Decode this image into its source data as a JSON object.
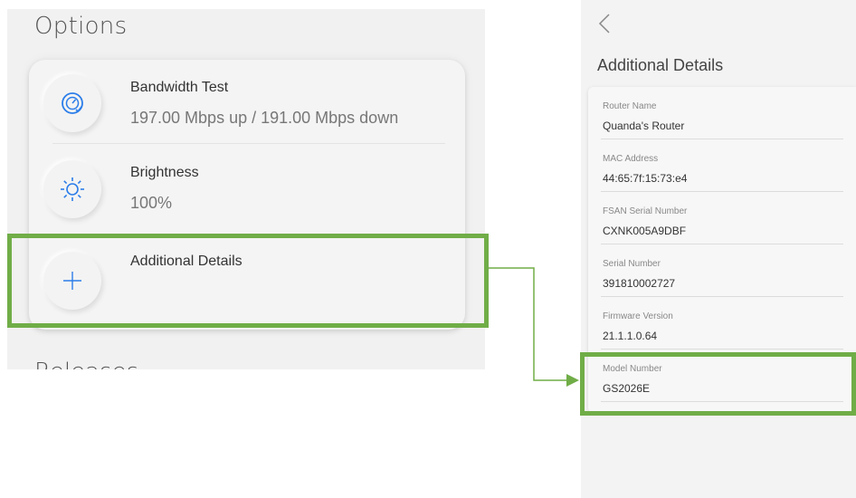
{
  "options_panel": {
    "title": "Options",
    "items": [
      {
        "icon": "speedometer-icon",
        "title": "Bandwidth Test",
        "subtitle": "197.00 Mbps up / 191.00 Mbps down"
      },
      {
        "icon": "brightness-icon",
        "title": "Brightness",
        "subtitle": "100%"
      },
      {
        "icon": "plus-icon",
        "title": "Additional Details",
        "subtitle": ""
      }
    ],
    "next_heading_partial": "Releases"
  },
  "details_panel": {
    "title": "Additional Details",
    "rows": [
      {
        "label": "Router Name",
        "value": "Quanda's Router"
      },
      {
        "label": "MAC Address",
        "value": "44:65:7f:15:73:e4"
      },
      {
        "label": "FSAN Serial Number",
        "value": "CXNK005A9DBF"
      },
      {
        "label": "Serial Number",
        "value": "391810002727"
      },
      {
        "label": "Firmware Version",
        "value": "21.1.1.0.64"
      },
      {
        "label": "Model Number",
        "value": "GS2026E"
      }
    ]
  },
  "colors": {
    "highlight": "#70ad47",
    "icon_blue": "#2b7de9"
  }
}
